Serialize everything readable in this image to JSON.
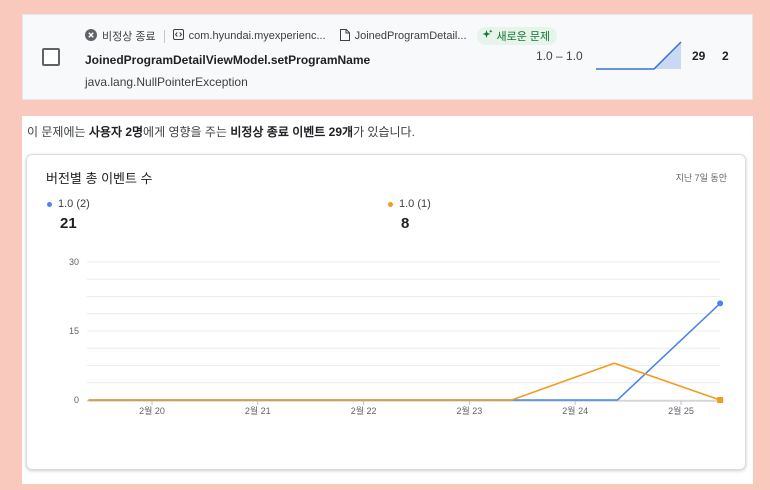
{
  "issue": {
    "status_label": "비정상 종료",
    "package_name": "com.hyundai.myexperienc...",
    "file_name": "JoinedProgramDetail...",
    "new_badge": "새로운 문제",
    "title": "JoinedProgramDetailViewModel.setProgramName",
    "subtitle": "java.lang.NullPointerException",
    "version_range": "1.0 – 1.0",
    "event_count": "29",
    "user_count": "2",
    "icons": {
      "status": "close-circle-icon",
      "package": "code-icon",
      "file": "document-icon",
      "badge": "sparkle-icon"
    },
    "colors": {
      "badge_bg": "#e6f4ea",
      "badge_text": "#137333",
      "sparkline": "#3b6fd4",
      "sparkline_fill": "#c9d9f5"
    }
  },
  "summary": {
    "prefix": "이 문제에는 ",
    "users": "사용자 2명",
    "middle": "에게 영향을 주는 ",
    "events": "비정상 종료 이벤트 29개",
    "suffix": "가 있습니다."
  },
  "chart": {
    "title": "버전별 총 이벤트 수",
    "period": "지난 7일 동안",
    "legend": [
      {
        "name": "1.0 (2)",
        "total": "21",
        "color": "#4a86e8"
      },
      {
        "name": "1.0 (1)",
        "total": "8",
        "color": "#f29c1f"
      }
    ]
  },
  "chart_data": {
    "type": "line",
    "x": [
      "2월 20",
      "2월 21",
      "2월 22",
      "2월 23",
      "2월 24",
      "2월 25"
    ],
    "y_ticks": [
      0,
      15,
      30
    ],
    "ylim": [
      0,
      30
    ],
    "grid": true,
    "series": [
      {
        "name": "1.0 (2)",
        "color": "#4a86e8",
        "points": [
          [
            19.4,
            0
          ],
          [
            20,
            0
          ],
          [
            21,
            0
          ],
          [
            22,
            0
          ],
          [
            23,
            0
          ],
          [
            24,
            0
          ],
          [
            24.4,
            0
          ],
          [
            25.37,
            21
          ]
        ]
      },
      {
        "name": "1.0 (1)",
        "color": "#f29c1f",
        "points": [
          [
            19.4,
            0
          ],
          [
            20,
            0
          ],
          [
            21,
            0
          ],
          [
            22,
            0
          ],
          [
            23,
            0
          ],
          [
            23.4,
            0
          ],
          [
            24.37,
            8
          ],
          [
            25.37,
            0
          ]
        ]
      }
    ]
  }
}
